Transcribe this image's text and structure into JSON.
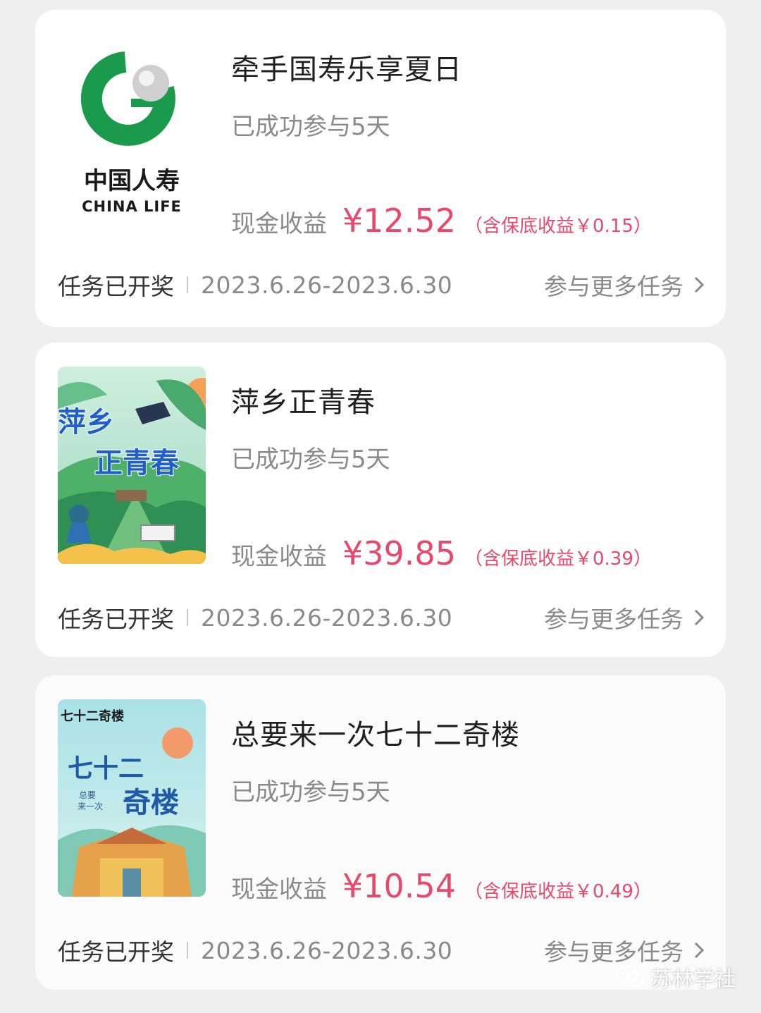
{
  "cards": [
    {
      "thumb": {
        "logo_cn": "中国人寿",
        "logo_en": "CHINA LIFE"
      },
      "title": "牵手国寿乐享夏日",
      "joined": "已成功参与5天",
      "earn_label": "现金收益",
      "amount": "¥12.52",
      "note": "（含保底收益￥0.15）",
      "status": "任务已开奖",
      "dates": "2023.6.26-2023.6.30",
      "more": "参与更多任务"
    },
    {
      "thumb": {
        "art_text_1": "萍乡",
        "art_text_2": "正青春"
      },
      "title": "萍乡正青春",
      "joined": "已成功参与5天",
      "earn_label": "现金收益",
      "amount": "¥39.85",
      "note": "（含保底收益￥0.39）",
      "status": "任务已开奖",
      "dates": "2023.6.26-2023.6.30",
      "more": "参与更多任务"
    },
    {
      "thumb": {
        "corner_text": "七十二奇楼",
        "art_text_1": "七十二",
        "art_text_2": "奇楼",
        "art_text_3": "总要",
        "art_text_4": "来一次"
      },
      "title": "总要来一次七十二奇楼",
      "joined": "已成功参与5天",
      "earn_label": "现金收益",
      "amount": "¥10.54",
      "note": "（含保底收益￥0.49）",
      "status": "任务已开奖",
      "dates": "2023.6.26-2023.6.30",
      "more": "参与更多任务"
    }
  ],
  "watermark": {
    "text": "苏林学社",
    "icon": "wechat-icon"
  },
  "colors": {
    "accent": "#e8486b",
    "muted": "#8a8a8a",
    "card_bg": "#ffffff",
    "page_bg": "#efefef"
  }
}
